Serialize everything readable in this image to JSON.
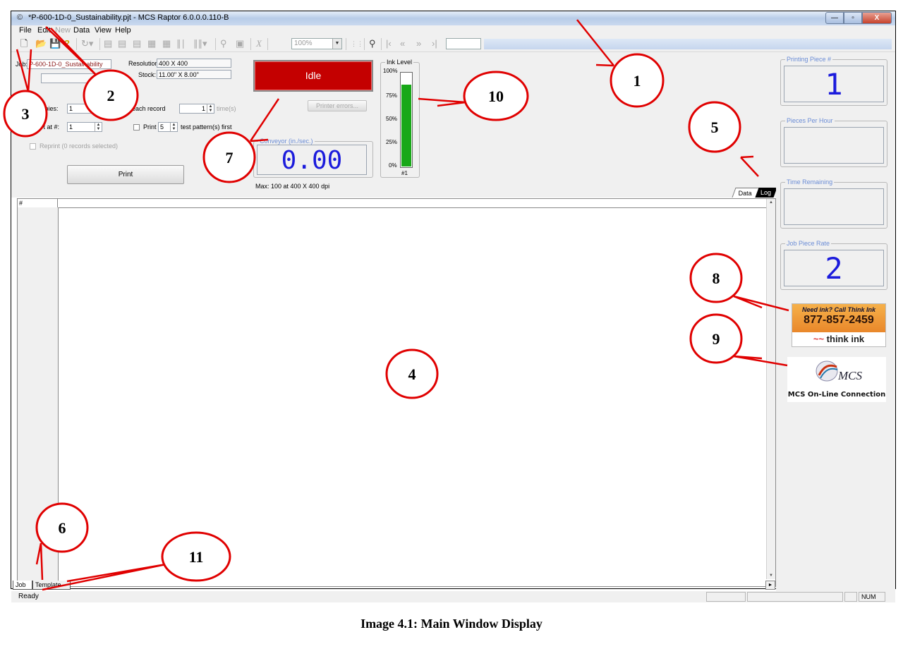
{
  "window": {
    "title": "*P-600-1D-0_Sustainability.pjt - MCS Raptor 6.0.0.0.110-B",
    "min_glyph": "—",
    "max_glyph": "▫",
    "close_glyph": "X"
  },
  "menu": [
    "File",
    "Edit",
    "New",
    "Data",
    "View",
    "Help"
  ],
  "toolbar": {
    "zoom_value": "100%"
  },
  "job": {
    "job_label": "Job:",
    "job_name": "P-600-1D-0_Sustainability",
    "resolution_label": "Resolution:",
    "resolution_value": "400 X 400",
    "stock_label": "Stock:",
    "stock_value": "11.00\" X 8.00\"",
    "copies_label": "Copies:",
    "copies_value": "1",
    "print_each_label": "Print each record",
    "print_each_value": "1",
    "times_label": "time(s)",
    "start_label": "Start at #:",
    "start_value": "1",
    "print_label": "Print",
    "test_count": "5",
    "test_label": "test pattern(s) first",
    "reprint_label": "Reprint (0 records selected)",
    "print_button": "Print"
  },
  "status": {
    "state": "Idle",
    "printer_errors": "Printer errors..."
  },
  "conveyor": {
    "title": "Conveyor (in./sec.)",
    "value": "0.00",
    "max": "Max: 100 at 400 X 400 dpi"
  },
  "ink": {
    "title": "Ink Level",
    "ticks": [
      "100%",
      "75%",
      "50%",
      "25%",
      "0%"
    ],
    "level_percent": 88,
    "cartridge": "#1"
  },
  "tabs": {
    "data": "Data",
    "log": "Log",
    "job": "Job",
    "template": "Template"
  },
  "grid": {
    "corner": "#"
  },
  "side": {
    "printing_piece_title": "Printing Piece #",
    "printing_piece_value": "1",
    "pieces_per_hour_title": "Pieces Per Hour",
    "pieces_per_hour_value": "",
    "time_remaining_title": "Time Remaining",
    "time_remaining_value": "",
    "job_piece_rate_title": "Job Piece Rate",
    "job_piece_rate_value": "2"
  },
  "ad": {
    "tagline": "Need ink? Call Think Ink",
    "phone": "877-857-2459",
    "brand": "think ink",
    "swoosh": "~~"
  },
  "mcs": {
    "logo": "MCS",
    "connection": "MCS On-Line Connection"
  },
  "statusbar": {
    "ready": "Ready",
    "num": "NUM"
  },
  "callouts": [
    "1",
    "2",
    "3",
    "4",
    "5",
    "6",
    "7",
    "8",
    "9",
    "10",
    "11"
  ],
  "caption": "Image 4.1: Main Window Display",
  "colors": {
    "callout_red": "#e00000",
    "idle_red": "#c40000",
    "ink_green": "#18a818",
    "lcd_blue": "#1b1bdc"
  }
}
